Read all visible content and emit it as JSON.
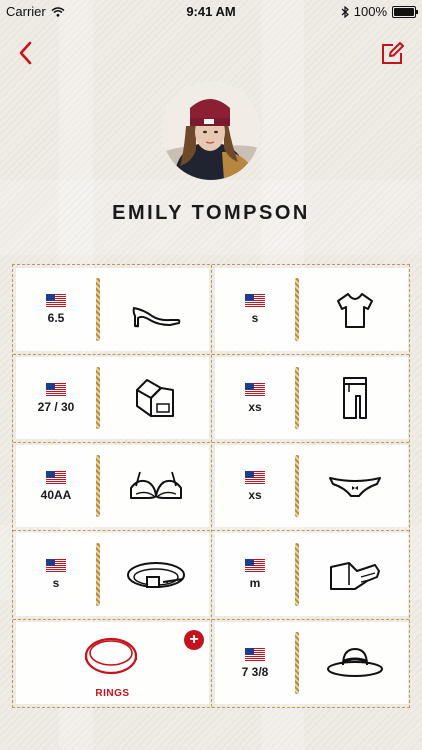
{
  "status_bar": {
    "carrier": "Carrier",
    "time": "9:41 AM",
    "battery": "100%"
  },
  "nav": {
    "back_icon": "chevron-left-icon",
    "edit_icon": "edit-icon"
  },
  "profile": {
    "name": "EMILY TOMPSON"
  },
  "accent_color": "#c4131c",
  "sizes": [
    {
      "item": "shoes",
      "value": "6.5",
      "flag": "us-flag-icon",
      "icon": "high-heel-icon"
    },
    {
      "item": "tops",
      "value": "s",
      "flag": "us-flag-icon",
      "icon": "tshirt-icon"
    },
    {
      "item": "jeans",
      "value": "27 / 30",
      "flag": "us-flag-icon",
      "icon": "jeans-icon"
    },
    {
      "item": "pants",
      "value": "xs",
      "flag": "us-flag-icon",
      "icon": "pants-icon"
    },
    {
      "item": "bra",
      "value": "40AA",
      "flag": "us-flag-icon",
      "icon": "bra-icon"
    },
    {
      "item": "underwear",
      "value": "xs",
      "flag": "us-flag-icon",
      "icon": "underwear-icon"
    },
    {
      "item": "belt",
      "value": "s",
      "flag": "us-flag-icon",
      "icon": "belt-icon"
    },
    {
      "item": "gloves",
      "value": "m",
      "flag": "us-flag-icon",
      "icon": "gloves-icon"
    },
    {
      "item": "hat",
      "value": "7 3/8",
      "flag": "us-flag-icon",
      "icon": "hat-icon"
    }
  ],
  "rings": {
    "label": "RINGS",
    "add_label": "+",
    "icon": "ring-icon"
  }
}
